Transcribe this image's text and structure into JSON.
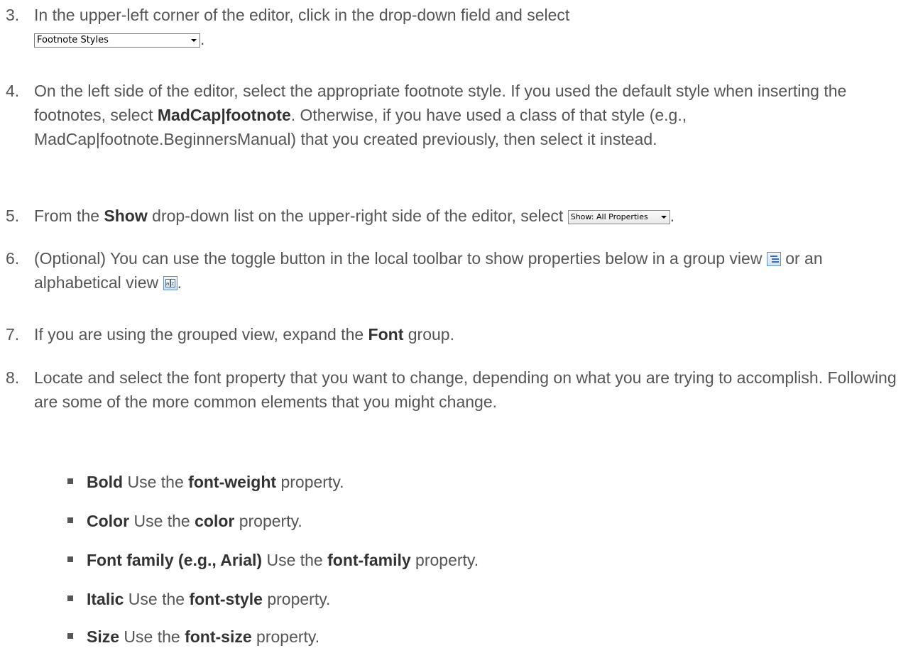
{
  "steps": [
    {
      "num": "3.",
      "text_before": "In the upper-left corner of the editor, click in the drop-down field and select",
      "dropdown_label": "Footnote Styles",
      "text_after": "."
    },
    {
      "num": "4.",
      "text_a": "On the left side of the editor, select the appropriate footnote style. If you used the default style when inserting the footnotes, select ",
      "bold_a": "MadCap|footnote",
      "text_b": ". Otherwise, if you have used a class of that style (e.g., MadCap|footnote.BeginnersManual) that you created previously, then select it instead."
    },
    {
      "num": "5.",
      "text_a": "From the ",
      "bold_a": "Show",
      "text_b": " drop-down list on the upper-right side of the editor, select ",
      "dropdown_label": "Show: All Properties",
      "text_after": "."
    },
    {
      "num": "6.",
      "text_a": "(Optional) You can use the toggle button in the local toolbar to show properties below in a group view ",
      "group_icon": "group-view-icon",
      "text_b": " or an alphabetical view ",
      "alpha_icon": "alphabetical-view-icon",
      "text_after": "."
    },
    {
      "num": "7.",
      "text_a": "If you are using the grouped view, expand the ",
      "bold_a": "Font",
      "text_b": " group."
    },
    {
      "num": "8.",
      "text": "Locate and select the font property that you want to change, depending on what you are trying to accomplish. Following are some of the more common elements that you might change."
    }
  ],
  "bullets": [
    {
      "term": "Bold",
      "mid": " Use the ",
      "prop": "font-weight",
      "end": " property."
    },
    {
      "term": "Color",
      "mid": " Use the ",
      "prop": "color",
      "end": " property."
    },
    {
      "term": "Font family (e.g., Arial)",
      "mid": " Use the ",
      "prop": "font-family",
      "end": " property."
    },
    {
      "term": "Italic",
      "mid": " Use the ",
      "prop": "font-style",
      "end": " property."
    },
    {
      "term": "Size",
      "mid": " Use the ",
      "prop": "font-size",
      "end": " property."
    }
  ],
  "colors": {
    "text": "#555555",
    "bold": "#333333"
  }
}
